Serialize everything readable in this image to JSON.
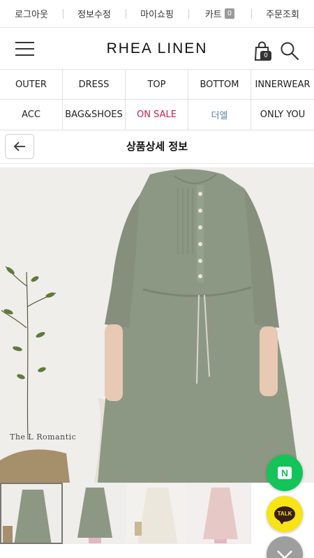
{
  "util_bar": {
    "logout": "로그아웃",
    "edit_info": "정보수정",
    "my_shopping": "마이쇼핑",
    "cart_label": "카트",
    "cart_count": "0",
    "order_lookup": "주문조회"
  },
  "header": {
    "logo": "RHEA LINEN",
    "bag_count": "0"
  },
  "categories": [
    "OUTER",
    "DRESS",
    "TOP",
    "BOTTOM",
    "INNERWEAR",
    "ACC",
    "BAG&SHOES",
    "ON SALE",
    "더엘",
    "ONLY YOU"
  ],
  "title_bar": {
    "title": "상품상세 정보"
  },
  "product": {
    "watermark": "The L Romantic"
  },
  "floating": {
    "naver_letter": "N",
    "kakao_label": "TALK"
  },
  "colors": {
    "sale": "#c0264a",
    "brand_category": "#5a7fa8",
    "naver_green": "#12c45a",
    "kakao_yellow": "#f7e316"
  }
}
